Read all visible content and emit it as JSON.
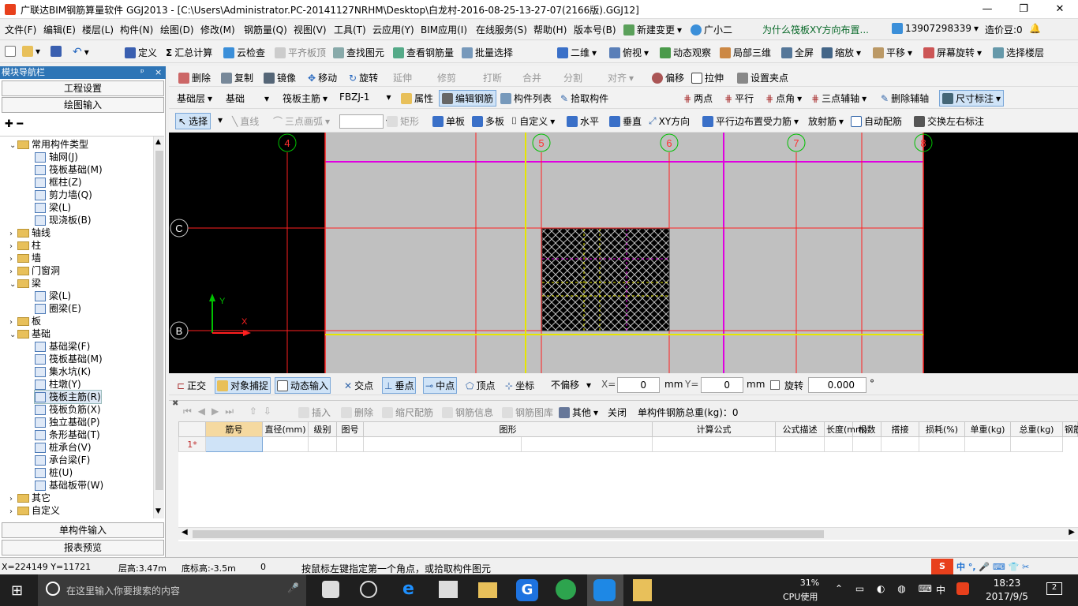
{
  "window": {
    "title": "广联达BIM钢筋算量软件 GGJ2013 - [C:\\Users\\Administrator.PC-20141127NRHM\\Desktop\\白龙村-2016-08-25-13-27-07(2166版).GGJ12]",
    "minimize": "—",
    "restore": "❐",
    "close": "✕"
  },
  "menu": [
    "文件(F)",
    "编辑(E)",
    "楼层(L)",
    "构件(N)",
    "绘图(D)",
    "修改(M)",
    "钢筋量(Q)",
    "视图(V)",
    "工具(T)",
    "云应用(Y)",
    "BIM应用(I)",
    "在线服务(S)",
    "帮助(H)",
    "版本号(B)",
    "新建变更",
    "广小二",
    "为什么筏板XY方向布置...",
    "13907298339",
    "造价豆:0"
  ],
  "toolbar1": [
    "定义",
    "汇总计算",
    "云检查",
    "平齐板顶",
    "查找图元",
    "查看钢筋量",
    "批量选择",
    "二维",
    "俯视",
    "动态观察",
    "局部三维",
    "全屏",
    "缩放",
    "平移",
    "屏幕旋转",
    "选择楼层"
  ],
  "toolbar2": [
    "删除",
    "复制",
    "镜像",
    "移动",
    "旋转",
    "延伸",
    "修剪",
    "打断",
    "合并",
    "分割",
    "对齐",
    "偏移",
    "拉伸",
    "设置夹点"
  ],
  "toolbar3": {
    "floor": "基础层",
    "category": "基础",
    "type": "筏板主筋",
    "name": "FBZJ-1",
    "items": [
      "属性",
      "编辑钢筋",
      "构件列表",
      "拾取构件",
      "两点",
      "平行",
      "点角",
      "三点辅轴",
      "删除辅轴",
      "尺寸标注"
    ]
  },
  "toolbar4": [
    "选择",
    "直线",
    "三点画弧",
    "矩形",
    "单板",
    "多板",
    "自定义",
    "水平",
    "垂直",
    "XY方向",
    "平行边布置受力筋",
    "放射筋",
    "自动配筋",
    "交换左右标注"
  ],
  "nav": {
    "header": "模块导航栏",
    "pin": "ᵖ",
    "close": "×",
    "engineering": "工程设置",
    "drawing": "绘图输入",
    "single": "单构件输入",
    "report": "报表预览"
  },
  "tree": [
    {
      "t": "常用构件类型",
      "lvl": 1,
      "folder": true,
      "open": true
    },
    {
      "t": "轴网(J)",
      "lvl": 2
    },
    {
      "t": "筏板基础(M)",
      "lvl": 2
    },
    {
      "t": "框柱(Z)",
      "lvl": 2
    },
    {
      "t": "剪力墙(Q)",
      "lvl": 2
    },
    {
      "t": "梁(L)",
      "lvl": 2
    },
    {
      "t": "现浇板(B)",
      "lvl": 2
    },
    {
      "t": "轴线",
      "lvl": 1,
      "folder": true
    },
    {
      "t": "柱",
      "lvl": 1,
      "folder": true
    },
    {
      "t": "墙",
      "lvl": 1,
      "folder": true
    },
    {
      "t": "门窗洞",
      "lvl": 1,
      "folder": true
    },
    {
      "t": "梁",
      "lvl": 1,
      "folder": true,
      "open": true
    },
    {
      "t": "梁(L)",
      "lvl": 2
    },
    {
      "t": "圈梁(E)",
      "lvl": 2
    },
    {
      "t": "板",
      "lvl": 1,
      "folder": true
    },
    {
      "t": "基础",
      "lvl": 1,
      "folder": true,
      "open": true
    },
    {
      "t": "基础梁(F)",
      "lvl": 2
    },
    {
      "t": "筏板基础(M)",
      "lvl": 2
    },
    {
      "t": "集水坑(K)",
      "lvl": 2
    },
    {
      "t": "柱墩(Y)",
      "lvl": 2
    },
    {
      "t": "筏板主筋(R)",
      "lvl": 2,
      "sel": true
    },
    {
      "t": "筏板负筋(X)",
      "lvl": 2
    },
    {
      "t": "独立基础(P)",
      "lvl": 2
    },
    {
      "t": "条形基础(T)",
      "lvl": 2
    },
    {
      "t": "桩承台(V)",
      "lvl": 2
    },
    {
      "t": "承台梁(F)",
      "lvl": 2
    },
    {
      "t": "桩(U)",
      "lvl": 2
    },
    {
      "t": "基础板带(W)",
      "lvl": 2
    },
    {
      "t": "其它",
      "lvl": 1,
      "folder": true
    },
    {
      "t": "自定义",
      "lvl": 1,
      "folder": true
    }
  ],
  "axes": {
    "cols": [
      "4",
      "5",
      "6",
      "7",
      "8"
    ],
    "rows": [
      "C",
      "B"
    ],
    "x_label": "X",
    "y_label": "Y"
  },
  "snapbar": {
    "items": [
      "正交",
      "对象捕捉",
      "动态输入",
      "交点",
      "垂点",
      "中点",
      "顶点",
      "坐标"
    ],
    "offset": "不偏移",
    "x_label": "X=",
    "x_val": "0",
    "y_label": "Y=",
    "y_val": "0",
    "unit": "mm",
    "rotate": "旋转",
    "rotate_val": "0.000",
    "deg": "°"
  },
  "rebarbar": {
    "items": [
      "插入",
      "删除",
      "缩尺配筋",
      "钢筋信息",
      "钢筋图库",
      "其他",
      "关闭"
    ],
    "total": "单构件钢筋总重(kg)：0"
  },
  "table": {
    "headers": [
      "筋号",
      "直径(mm)",
      "级别",
      "图号",
      "图形",
      "计算公式",
      "公式描述",
      "长度(mm)",
      "根数",
      "搭接",
      "损耗(%)",
      "单重(kg)",
      "总重(kg)",
      "钢筋归类"
    ],
    "row_label": "1*"
  },
  "status": {
    "coords": "X=224149 Y=11721",
    "floor_h": "层高:3.47m",
    "bottom": "底标高:-3.5m",
    "num": "0",
    "hint": "按鼠标左键指定第一个角点，或拾取构件图元"
  },
  "taskbar": {
    "search": "在这里输入你要搜索的内容",
    "cpu": "31%",
    "cpu_label": "CPU使用",
    "time": "18:23",
    "date": "2017/9/5",
    "ime": "中",
    "notif": "2"
  }
}
